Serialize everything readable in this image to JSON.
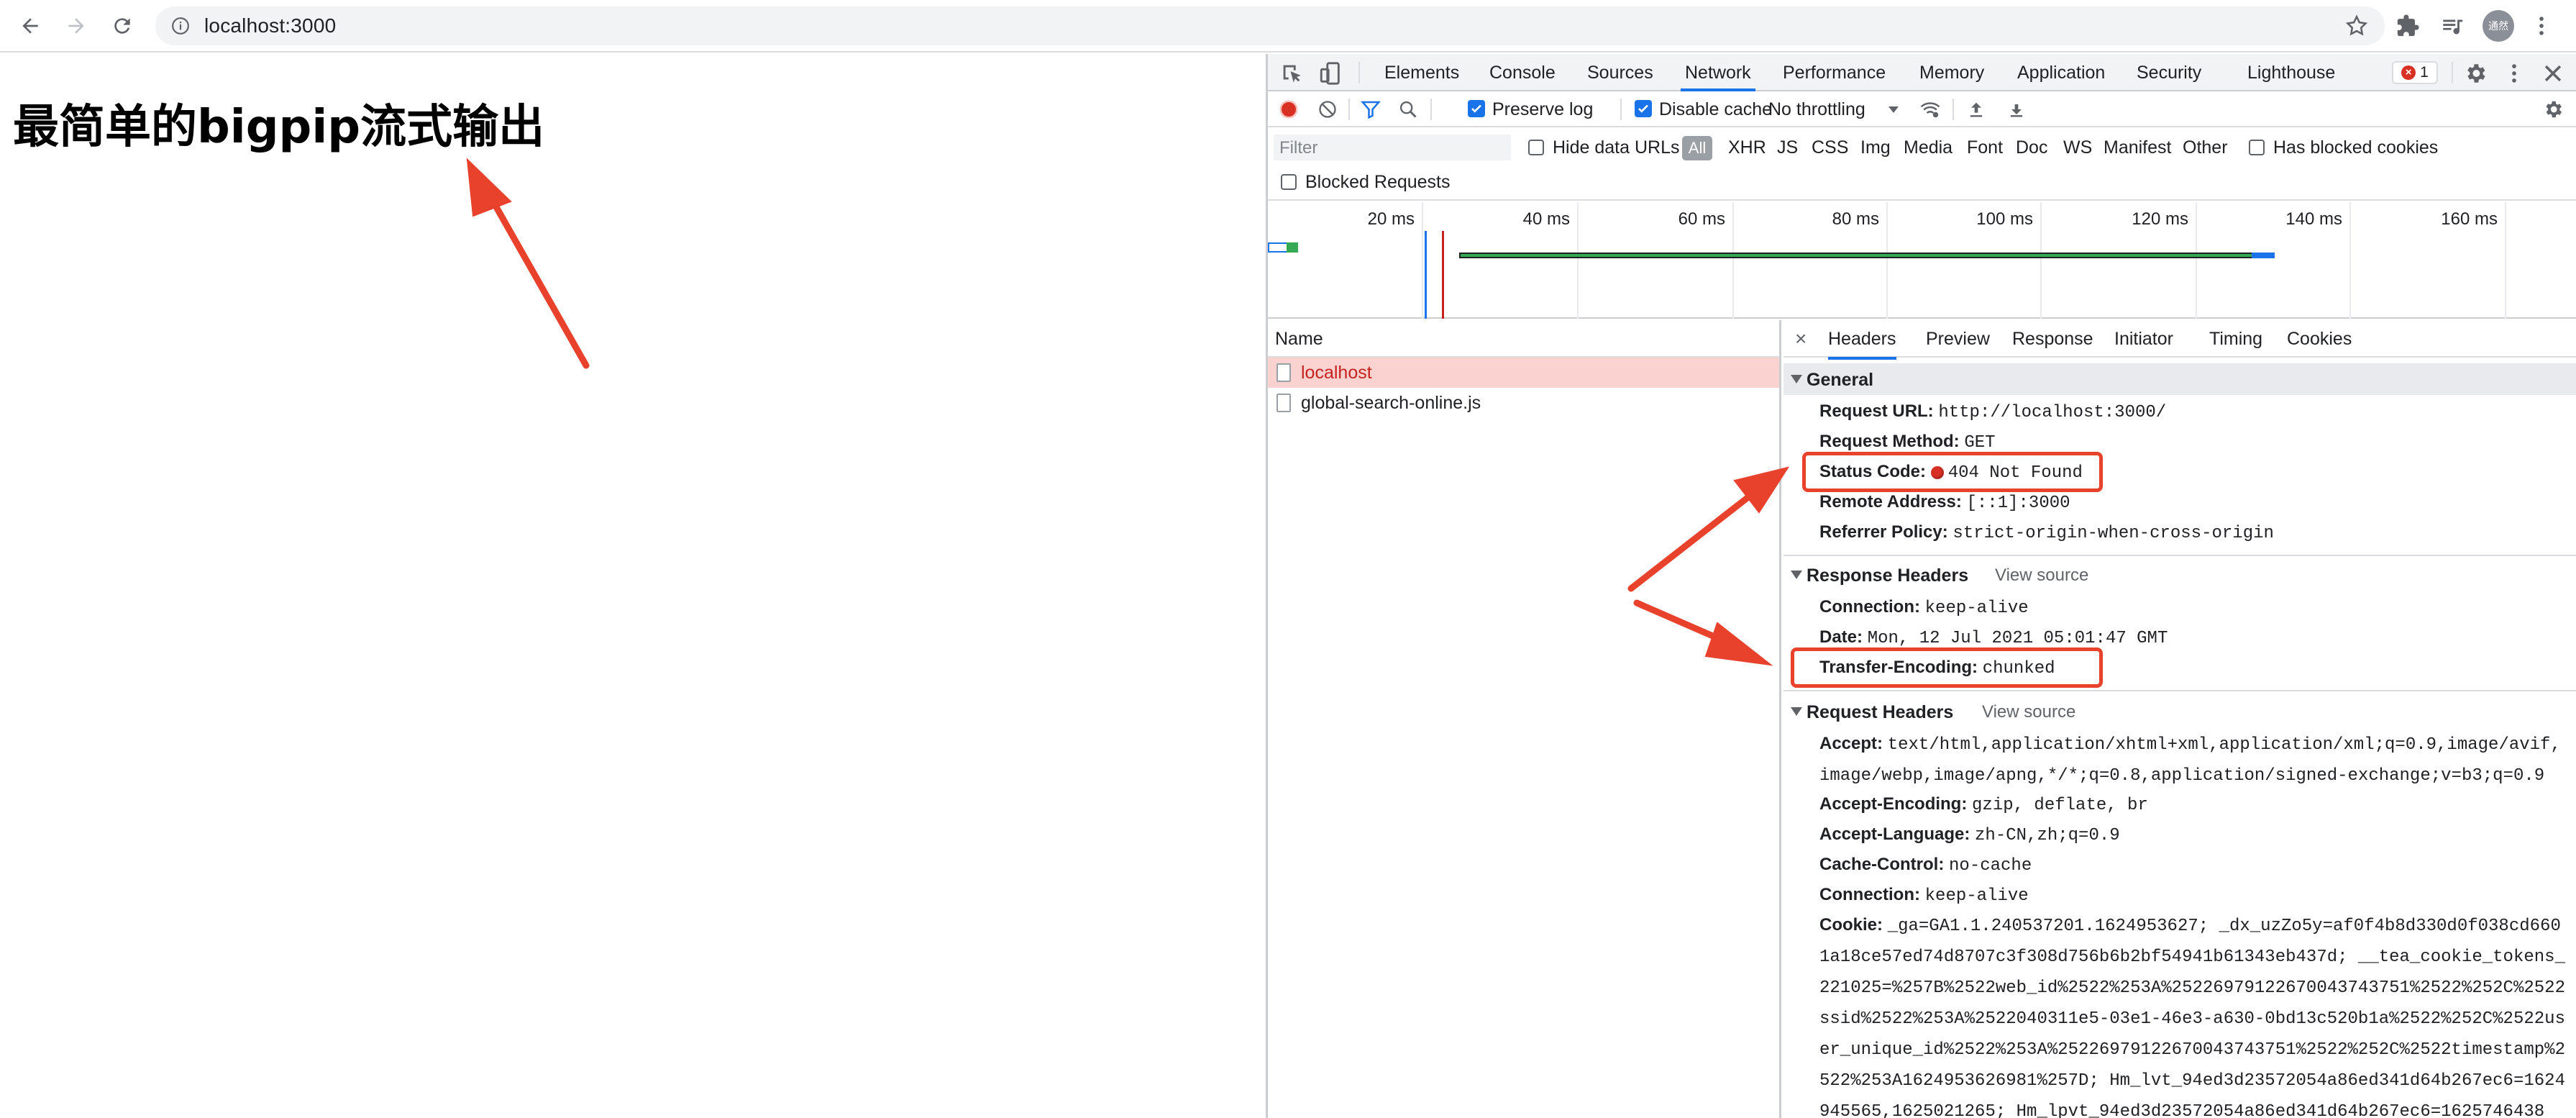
{
  "browser": {
    "url": "localhost:3000",
    "avatar_text": "通然"
  },
  "page": {
    "title": "最简单的bigpip流式输出"
  },
  "devtools": {
    "tabs": [
      "Elements",
      "Console",
      "Sources",
      "Network",
      "Performance",
      "Memory",
      "Application",
      "Security",
      "Lighthouse"
    ],
    "active_tab": "Network",
    "error_count": "1",
    "toolbar": {
      "preserve_log": "Preserve log",
      "disable_cache": "Disable cache",
      "throttling": "No throttling"
    },
    "filter": {
      "placeholder": "Filter",
      "hide_data_urls": "Hide data URLs",
      "all": "All",
      "types": [
        "XHR",
        "JS",
        "CSS",
        "Img",
        "Media",
        "Font",
        "Doc",
        "WS",
        "Manifest",
        "Other"
      ],
      "has_blocked_cookies": "Has blocked cookies",
      "blocked_requests": "Blocked Requests"
    },
    "timeline": {
      "ticks": [
        "20 ms",
        "40 ms",
        "60 ms",
        "80 ms",
        "100 ms",
        "120 ms",
        "140 ms",
        "160 ms"
      ]
    },
    "requests": {
      "header": "Name",
      "items": [
        "localhost",
        "global-search-online.js"
      ]
    },
    "detail_tabs": [
      "Headers",
      "Preview",
      "Response",
      "Initiator",
      "Timing",
      "Cookies"
    ],
    "general": {
      "title": "General",
      "request_url_k": "Request URL:",
      "request_url_v": "http://localhost:3000/",
      "request_method_k": "Request Method:",
      "request_method_v": "GET",
      "status_code_k": "Status Code:",
      "status_code_v": "404 Not Found",
      "remote_address_k": "Remote Address:",
      "remote_address_v": "[::1]:3000",
      "referrer_policy_k": "Referrer Policy:",
      "referrer_policy_v": "strict-origin-when-cross-origin"
    },
    "response_headers": {
      "title": "Response Headers",
      "view_source": "View source",
      "connection_k": "Connection:",
      "connection_v": "keep-alive",
      "date_k": "Date:",
      "date_v": "Mon, 12 Jul 2021 05:01:47 GMT",
      "transfer_encoding_k": "Transfer-Encoding:",
      "transfer_encoding_v": "chunked"
    },
    "request_headers": {
      "title": "Request Headers",
      "view_source": "View source",
      "accept_k": "Accept:",
      "accept_v": "text/html,application/xhtml+xml,application/xml;q=0.9,image/avif,image/webp,image/apng,*/*;q=0.8,application/signed-exchange;v=b3;q=0.9",
      "accept_encoding_k": "Accept-Encoding:",
      "accept_encoding_v": "gzip, deflate, br",
      "accept_language_k": "Accept-Language:",
      "accept_language_v": "zh-CN,zh;q=0.9",
      "cache_control_k": "Cache-Control:",
      "cache_control_v": "no-cache",
      "connection_k": "Connection:",
      "connection_v": "keep-alive",
      "cookie_k": "Cookie:",
      "cookie_v": "_ga=GA1.1.240537201.1624953627; _dx_uzZo5y=af0f4b8d330d0f038cd6601a18ce57ed74d8707c3f308d756b6b2bf54941b61343eb437d; __tea_cookie_tokens_221025=%257B%2522web_id%2522%253A%25226979122670043743751%2522%252C%2522ssid%2522%253A%2522040311e5-03e1-46e3-a630-0bd13c520b1a%2522%252C%2522user_unique_id%2522%253A%25226979122670043743751%2522%252C%2522timestamp%2522%253A1624953626981%257D; Hm_lvt_94ed3d23572054a86ed341d64b267ec6=1624945565,1625021265; Hm_lpvt_94ed3d23572054a86ed341d64b267ec6=1625746438"
    }
  },
  "colors": {
    "accent": "#1a73e8",
    "annotation": "#e8412c",
    "error": "#d93025",
    "selected_row": "#fad2cf"
  }
}
